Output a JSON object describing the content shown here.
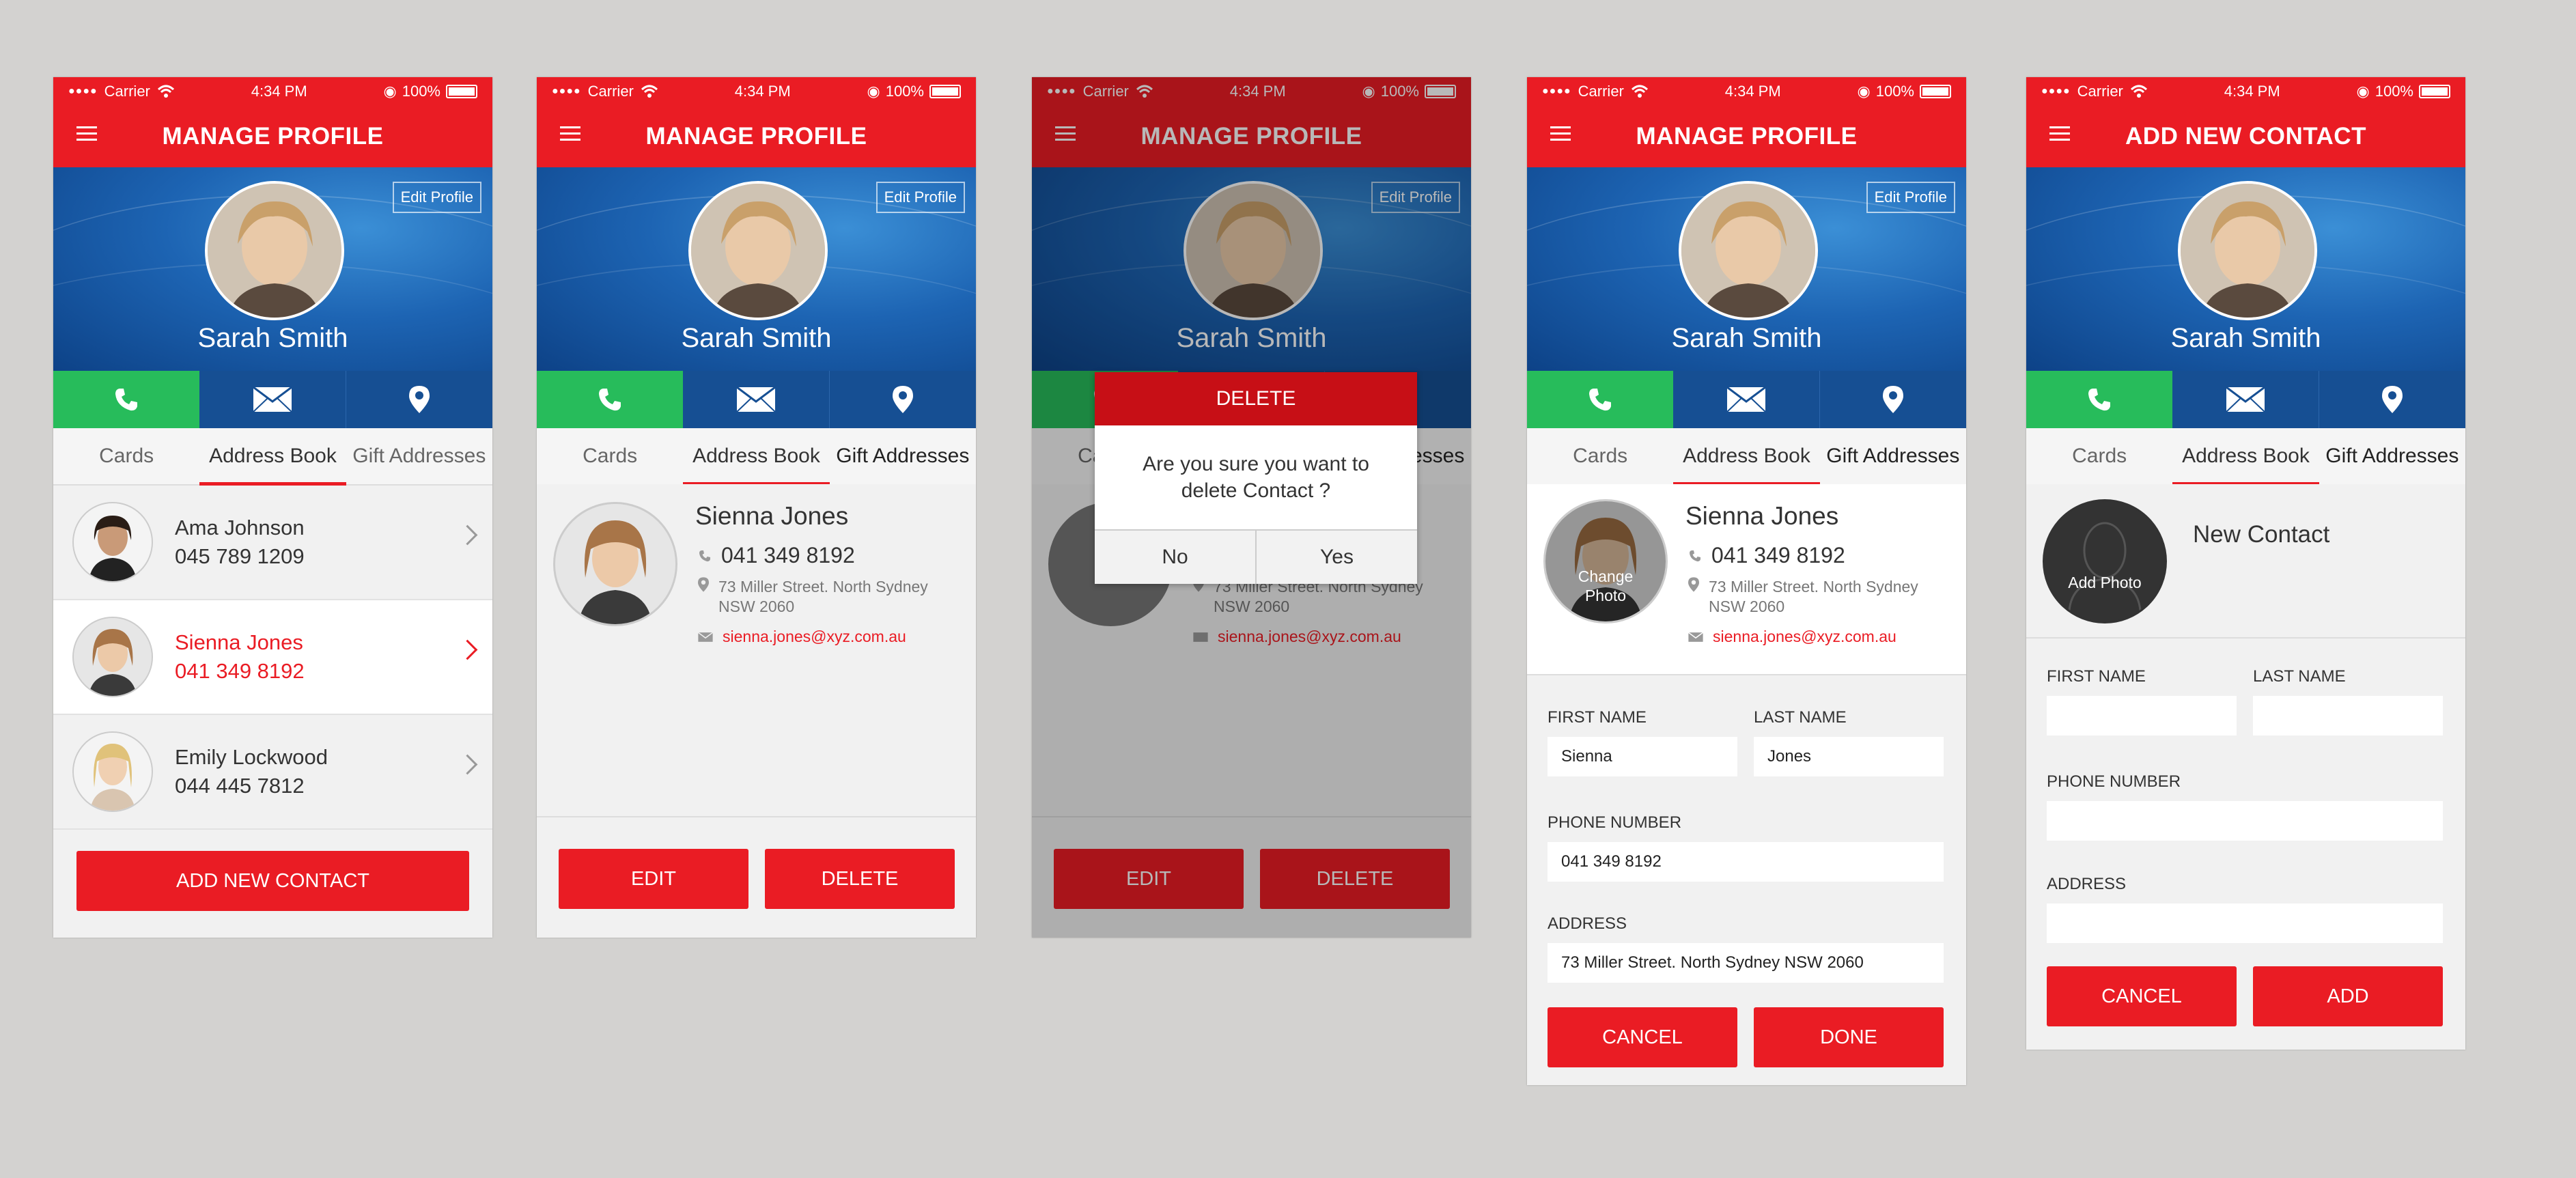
{
  "status": {
    "carrier": "Carrier",
    "time": "4:34 PM",
    "battery": "100%"
  },
  "profile": {
    "name": "Sarah Smith",
    "edit_label": "Edit Profile"
  },
  "titles": {
    "manage": "MANAGE PROFILE",
    "add": "ADD NEW CONTACT"
  },
  "tabs": [
    "Cards",
    "Address Book",
    "Gift Addresses"
  ],
  "contacts": [
    {
      "name": "Ama Johnson",
      "phone": "045 789 1209"
    },
    {
      "name": "Sienna Jones",
      "phone": "041 349 8192"
    },
    {
      "name": "Emily Lockwood",
      "phone": "044 445 7812"
    }
  ],
  "detail": {
    "name": "Sienna Jones",
    "phone": "041 349 8192",
    "address_line1": "73 Miller Street. North Sydney",
    "address_line2": "NSW 2060",
    "email": "sienna.jones@xyz.com.au"
  },
  "buttons": {
    "add_contact": "ADD NEW CONTACT",
    "edit": "EDIT",
    "delete": "DELETE",
    "cancel": "CANCEL",
    "done": "DONE",
    "add": "ADD"
  },
  "dialog": {
    "title": "DELETE",
    "message": "Are you sure you want to delete Contact ?",
    "no": "No",
    "yes": "Yes"
  },
  "form": {
    "first_name_label": "FIRST NAME",
    "last_name_label": "LAST NAME",
    "phone_label": "PHONE NUMBER",
    "address_label": "ADDRESS",
    "first_name_value": "Sienna",
    "last_name_value": "Jones",
    "phone_value": "041 349 8192",
    "address_value": "73 Miller Street. North Sydney NSW 2060",
    "change_photo": "Change Photo"
  },
  "new_contact": {
    "title": "New Contact",
    "add_photo": "Add Photo"
  },
  "colors": {
    "brand_red": "#ea1c24",
    "dialog_red": "#c70f16",
    "call_green": "#27bc5b",
    "nav_blue": "#164f93"
  },
  "icons": [
    "hamburger-icon",
    "wifi-icon",
    "lock-rotation-icon",
    "battery-icon",
    "phone-icon",
    "mail-icon",
    "location-pin-icon",
    "chevron-right-icon"
  ]
}
